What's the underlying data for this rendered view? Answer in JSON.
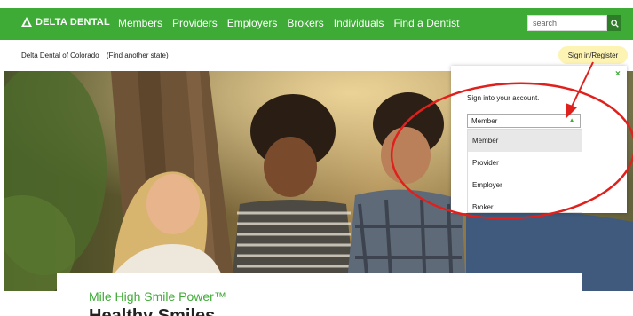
{
  "header": {
    "logo_text": "DELTA DENTAL",
    "nav": [
      "Members",
      "Providers",
      "Employers",
      "Brokers",
      "Individuals",
      "Find a Dentist"
    ],
    "search_placeholder": "search"
  },
  "subbar": {
    "state": "Delta Dental of Colorado",
    "change_state": "(Find another state)",
    "signin": "Sign in/Register"
  },
  "popup": {
    "close": "×",
    "prompt": "Sign into your account.",
    "selected": "Member",
    "options": [
      "Member",
      "Provider",
      "Employer",
      "Broker"
    ]
  },
  "card": {
    "title": "Mile High Smile Power™",
    "subtitle": "Healthy Smiles"
  },
  "colors": {
    "brand_green": "#3eab36",
    "annotation_red": "#e0201c",
    "highlight_yellow": "#fdf3b3"
  }
}
